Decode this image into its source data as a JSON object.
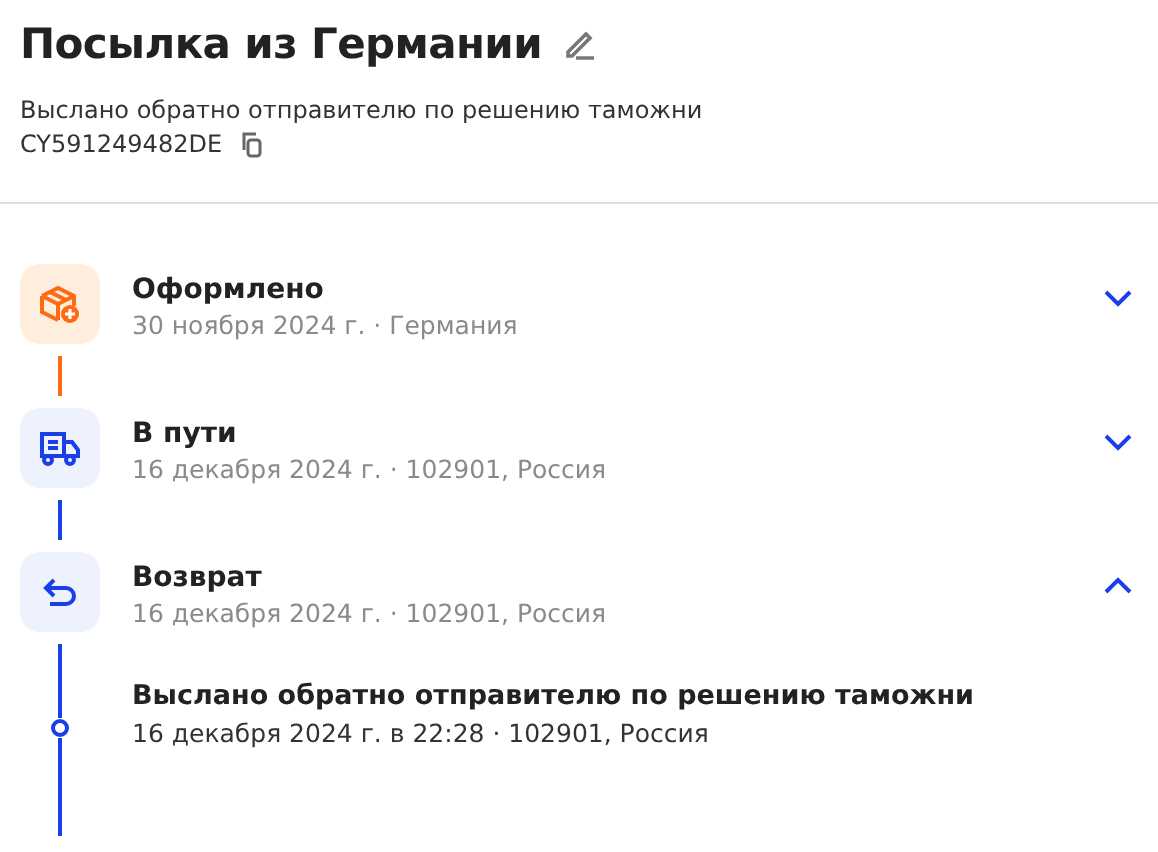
{
  "header": {
    "title": "Посылка из Германии",
    "status": "Выслано обратно отправителю по решению таможни",
    "tracking_number": "CY591249482DE"
  },
  "steps": [
    {
      "kind": "created",
      "color": "#ff6a13",
      "title": "Оформлено",
      "details": "30 ноября 2024 г. · Германия",
      "expanded": false
    },
    {
      "kind": "transit",
      "color": "#1a3ee8",
      "title": "В пути",
      "details": "16 декабря 2024 г. · 102901, Россия",
      "expanded": false
    },
    {
      "kind": "return",
      "color": "#1a3ee8",
      "title": "Возврат",
      "details": "16 декабря 2024 г. · 102901, Россия",
      "expanded": true,
      "events": [
        {
          "title": "Выслано обратно отправителю по решению таможни",
          "details": "16 декабря 2024 г. в 22:28 · 102901, Россия"
        }
      ]
    }
  ]
}
